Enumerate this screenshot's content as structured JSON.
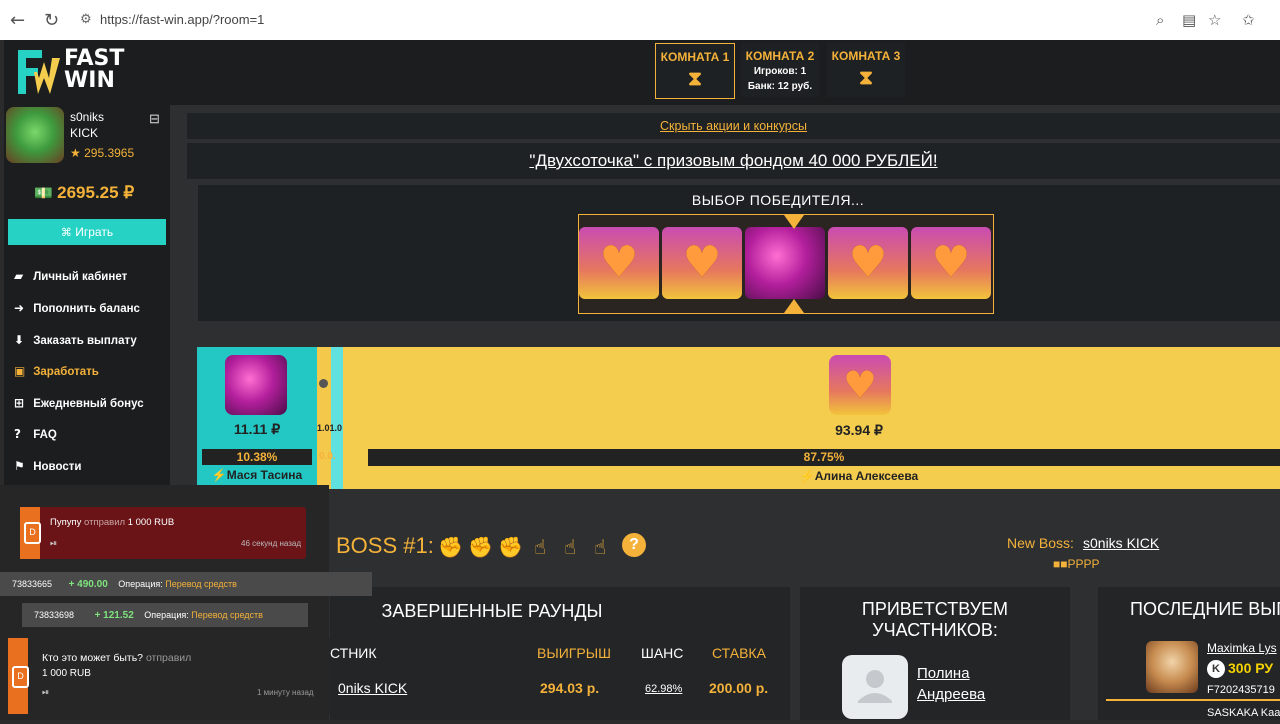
{
  "browser": {
    "url": "https://fast-win.app/?room=1"
  },
  "logo": {
    "mark": "FW",
    "line1": "FAST",
    "line2": "WIN"
  },
  "rooms": [
    {
      "name": "КОМНАТА 1",
      "info1": "",
      "info2": ""
    },
    {
      "name": "КОМНАТА 2",
      "info1": "Игроков: 1",
      "info2": "Банк: 12 руб."
    },
    {
      "name": "КОМНАТА 3",
      "info1": "",
      "info2": ""
    }
  ],
  "user": {
    "name": "s0niks",
    "tag": "KICK",
    "rating": "★ 295.3965",
    "balance": "2695.25 ₽",
    "play_label": "Играть"
  },
  "menu": [
    {
      "label": "Личный кабинет",
      "icon": "briefcase-icon"
    },
    {
      "label": "Пополнить баланс",
      "icon": "arrow-right-circle-icon"
    },
    {
      "label": "Заказать выплату",
      "icon": "arrow-down-circle-icon"
    },
    {
      "label": "Заработать",
      "icon": "money-icon"
    },
    {
      "label": "Ежедневный бонус",
      "icon": "gift-icon"
    },
    {
      "label": "FAQ",
      "icon": "question-icon"
    },
    {
      "label": "Новости",
      "icon": "bookmark-icon"
    }
  ],
  "promo": {
    "toggle": "Скрыть акции и конкурсы",
    "banner": "\"Двухсоточка\" с призовым фондом 40 000 РУБЛЕЙ!"
  },
  "roulette": {
    "title": "ВЫБОР ПОБЕДИТЕЛЯ..."
  },
  "players": [
    {
      "bet": "11.11 ₽",
      "chance": "10.38%",
      "name": "⚡Мася Тасина"
    },
    {
      "bet": "1.01.0",
      "chance": "0.0."
    },
    {
      "bet": "93.94 ₽",
      "chance": "87.75%",
      "name": "⚡Алина Алексеева"
    }
  ],
  "boss": {
    "label": "BOSS #1:",
    "new_label": "New Boss:",
    "new_name": "s0niks KICK",
    "flags": "■■PPPP"
  },
  "rounds": {
    "title": "ЗАВЕРШЕННЫЕ РАУНДЫ",
    "headers": {
      "player": "СТНИК",
      "win": "ВЫИГРЫШ",
      "chance": "ШАНС",
      "bet": "СТАВКА"
    },
    "row": {
      "player": "0niks KICK",
      "win": "294.03 р.",
      "chance": "62.98%",
      "bet": "200.00 р."
    }
  },
  "welcome": {
    "title1": "ПРИВЕТСТВУЕМ",
    "title2": "УЧАСТНИКОВ:",
    "name1": "Полина",
    "name2": "Андреева"
  },
  "last": {
    "title": "ПОСЛЕДНИЕ ВЫП",
    "user": "Maximka Lys",
    "k": "K",
    "amount": "300 РУ",
    "code": "F7202435719",
    "user2": "SASKAKA Kaa"
  },
  "notifications": [
    {
      "who": "Пупупу",
      "action": "отправил",
      "amount": "1 000 RUB",
      "time": "46 секунд назад"
    },
    {
      "who": "Кто это может быть?",
      "action": "отправил",
      "amount": "1 000 RUB",
      "time": "1 минуту назад"
    }
  ],
  "operations": [
    {
      "id": "73833665",
      "amount": "+ 490.00",
      "label": "Операция:",
      "link": "Перевод средств"
    },
    {
      "id": "73833698",
      "amount": "+ 121.52",
      "label": "Операция:",
      "link": "Перевод средств"
    }
  ],
  "colors": {
    "accent": "#f4b23a",
    "teal": "#25d2c4",
    "yellow": "#f4cd4e"
  }
}
